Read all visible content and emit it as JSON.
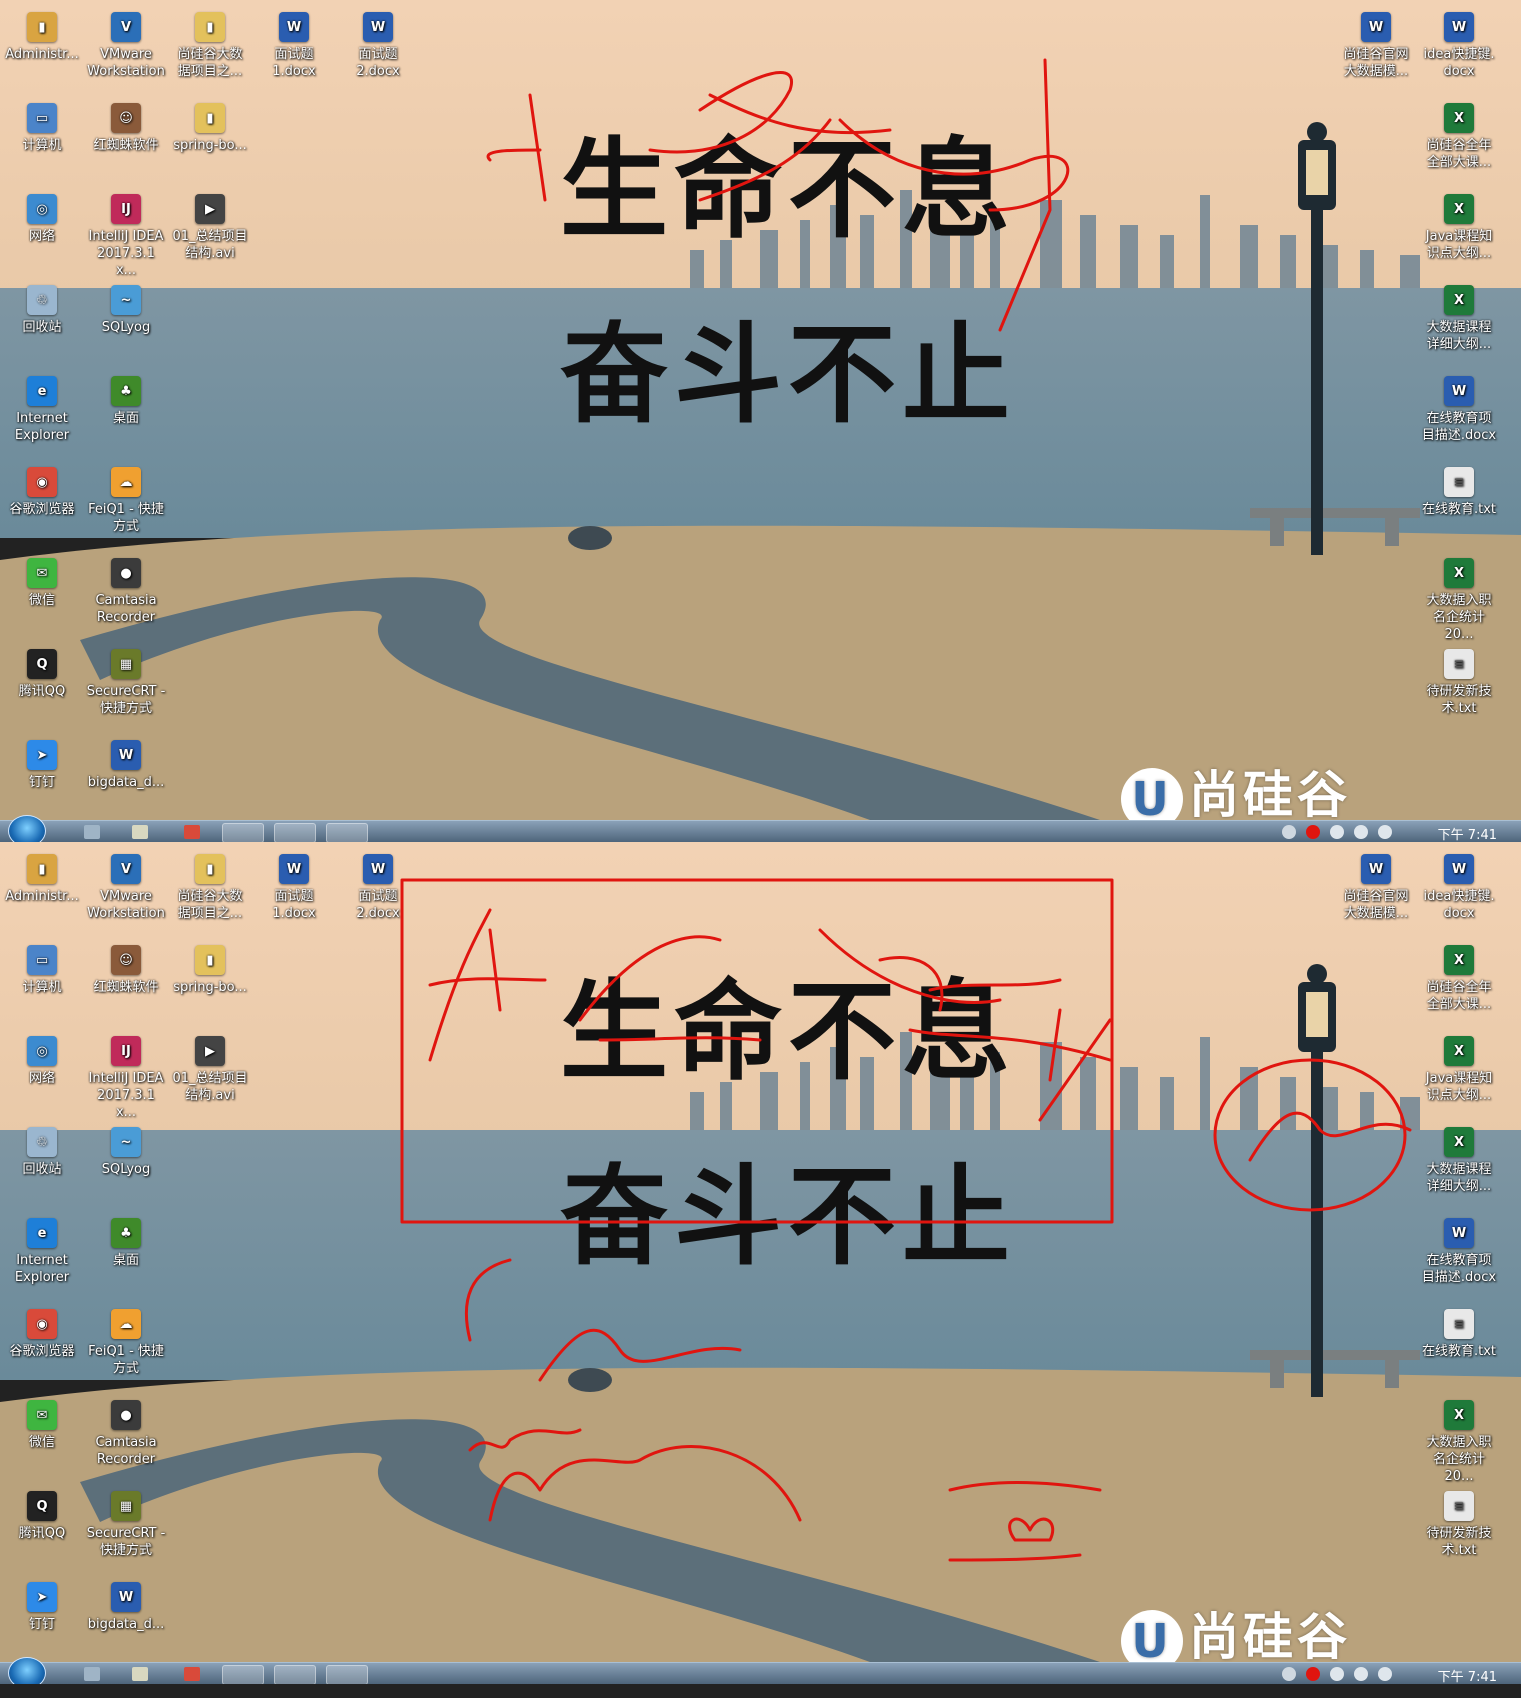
{
  "panels": [
    {
      "id": "top",
      "desktop_left": [
        {
          "name": "administrator-folder",
          "label": "Administr...",
          "color": "#d9a441",
          "glyph": "▮"
        },
        {
          "name": "vmware-workstation",
          "label": "VMware\nWorkstation",
          "color": "#2b6fb8",
          "glyph": "V"
        },
        {
          "name": "shangguigu-bigdata-folder",
          "label": "尚硅谷大数\n据项目之...",
          "color": "#e3c15c",
          "glyph": "▮"
        },
        {
          "name": "interview-1-docx",
          "label": "面试题\n1.docx",
          "color": "#2a5db0",
          "glyph": "W"
        },
        {
          "name": "interview-2-docx",
          "label": "面试题\n2.docx",
          "color": "#2a5db0",
          "glyph": "W"
        },
        {
          "name": "computer",
          "label": "计算机",
          "color": "#4b84c9",
          "glyph": "▭"
        },
        {
          "name": "hongzhizhu-software",
          "label": "红蜘蛛软件",
          "color": "#8a5a3a",
          "glyph": "☺"
        },
        {
          "name": "spring-boot-folder",
          "label": "spring-bo...",
          "color": "#e3c15c",
          "glyph": "▮"
        },
        {
          "name": "network",
          "label": "网络",
          "color": "#3c8bd0",
          "glyph": "◎"
        },
        {
          "name": "intellij-idea",
          "label": "IntelliJ IDEA\n2017.3.1 x...",
          "color": "#c02a5a",
          "glyph": "IJ"
        },
        {
          "name": "summary-video",
          "label": "01_总结项目\n结构.avi",
          "color": "#444",
          "glyph": "▶"
        },
        {
          "name": "recycle-bin",
          "label": "回收站",
          "color": "#9ab6cf",
          "glyph": "♲"
        },
        {
          "name": "sqlyog",
          "label": "SQLyog",
          "color": "#4a9cd6",
          "glyph": "~"
        },
        {
          "name": "internet-explorer",
          "label": "Internet\nExplorer",
          "color": "#1e7fd8",
          "glyph": "e"
        },
        {
          "name": "desktop-tree",
          "label": "桌面",
          "color": "#3f8a2a",
          "glyph": "♣"
        },
        {
          "name": "browser",
          "label": "谷歌浏览器",
          "color": "#d94a3a",
          "glyph": "◉"
        },
        {
          "name": "feiq",
          "label": "FeiQ1 - 快捷\n方式",
          "color": "#f0a030",
          "glyph": "☁"
        },
        {
          "name": "wechat",
          "label": "微信",
          "color": "#3fb540",
          "glyph": "✉"
        },
        {
          "name": "camtasia-recorder",
          "label": "Camtasia\nRecorder",
          "color": "#3b3b3b",
          "glyph": "●"
        },
        {
          "name": "tencent-qq",
          "label": "腾讯QQ",
          "color": "#222",
          "glyph": "Q"
        },
        {
          "name": "securecrt",
          "label": "SecureCRT -\n快捷方式",
          "color": "#6a7a2a",
          "glyph": "▦"
        },
        {
          "name": "dingtalk",
          "label": "钉钉",
          "color": "#2d8ae8",
          "glyph": "➤"
        },
        {
          "name": "bigdata-doc",
          "label": "bigdata_d...",
          "color": "#2a5db0",
          "glyph": "W"
        }
      ],
      "desktop_right": [
        {
          "name": "shangguigu-website-doc",
          "label": "尚硅谷官网\n大数据模...",
          "color": "#2a5db0",
          "glyph": "W"
        },
        {
          "name": "idea-shortcuts-doc",
          "label": "idea快捷键.\ndocx",
          "color": "#2a5db0",
          "glyph": "W"
        },
        {
          "name": "course-list-xls",
          "label": "尚硅谷全年\n全部大课...",
          "color": "#1f7a3a",
          "glyph": "X"
        },
        {
          "name": "java-course-xls",
          "label": "Java课程知\n识点大纲...",
          "color": "#1f7a3a",
          "glyph": "X"
        },
        {
          "name": "bigdata-course-xls",
          "label": "大数据课程\n详细大纲...",
          "color": "#1f7a3a",
          "glyph": "X"
        },
        {
          "name": "online-edu-doc",
          "label": "在线教育项\n目描述.docx",
          "color": "#2a5db0",
          "glyph": "W"
        },
        {
          "name": "online-edu-txt",
          "label": "在线教育.txt",
          "color": "#e8e8e8",
          "glyph": "≡"
        },
        {
          "name": "bigdata-jobs-xls",
          "label": "大数据入职\n名企统计20...",
          "color": "#1f7a3a",
          "glyph": "X"
        },
        {
          "name": "new-tech-txt",
          "label": "待研发新技\n术.txt",
          "color": "#e8e8e8",
          "glyph": "≡"
        }
      ],
      "callig_line1": "生命不息",
      "callig_line2": "奋斗不止",
      "logo_text": "尚硅谷",
      "logo_mark": "U",
      "clock": "下午 7:41"
    },
    {
      "id": "bottom",
      "desktop_left": [
        {
          "name": "administrator-folder",
          "label": "Administr...",
          "color": "#d9a441",
          "glyph": "▮"
        },
        {
          "name": "vmware-workstation",
          "label": "VMware\nWorkstation",
          "color": "#2b6fb8",
          "glyph": "V"
        },
        {
          "name": "shangguigu-bigdata-folder",
          "label": "尚硅谷大数\n据项目之...",
          "color": "#e3c15c",
          "glyph": "▮"
        },
        {
          "name": "interview-1-docx",
          "label": "面试题\n1.docx",
          "color": "#2a5db0",
          "glyph": "W"
        },
        {
          "name": "interview-2-docx",
          "label": "面试题\n2.docx",
          "color": "#2a5db0",
          "glyph": "W"
        },
        {
          "name": "computer",
          "label": "计算机",
          "color": "#4b84c9",
          "glyph": "▭"
        },
        {
          "name": "hongzhizhu-software",
          "label": "红蜘蛛软件",
          "color": "#8a5a3a",
          "glyph": "☺"
        },
        {
          "name": "spring-boot-folder",
          "label": "spring-bo...",
          "color": "#e3c15c",
          "glyph": "▮"
        },
        {
          "name": "network",
          "label": "网络",
          "color": "#3c8bd0",
          "glyph": "◎"
        },
        {
          "name": "intellij-idea",
          "label": "IntelliJ IDEA\n2017.3.1 x...",
          "color": "#c02a5a",
          "glyph": "IJ"
        },
        {
          "name": "summary-video",
          "label": "01_总结项目\n结构.avi",
          "color": "#444",
          "glyph": "▶"
        },
        {
          "name": "recycle-bin",
          "label": "回收站",
          "color": "#9ab6cf",
          "glyph": "♲"
        },
        {
          "name": "sqlyog",
          "label": "SQLyog",
          "color": "#4a9cd6",
          "glyph": "~"
        },
        {
          "name": "internet-explorer",
          "label": "Internet\nExplorer",
          "color": "#1e7fd8",
          "glyph": "e"
        },
        {
          "name": "desktop-tree",
          "label": "桌面",
          "color": "#3f8a2a",
          "glyph": "♣"
        },
        {
          "name": "browser",
          "label": "谷歌浏览器",
          "color": "#d94a3a",
          "glyph": "◉"
        },
        {
          "name": "feiq",
          "label": "FeiQ1 - 快捷\n方式",
          "color": "#f0a030",
          "glyph": "☁"
        },
        {
          "name": "wechat",
          "label": "微信",
          "color": "#3fb540",
          "glyph": "✉"
        },
        {
          "name": "camtasia-recorder",
          "label": "Camtasia\nRecorder",
          "color": "#3b3b3b",
          "glyph": "●"
        },
        {
          "name": "tencent-qq",
          "label": "腾讯QQ",
          "color": "#222",
          "glyph": "Q"
        },
        {
          "name": "securecrt",
          "label": "SecureCRT -\n快捷方式",
          "color": "#6a7a2a",
          "glyph": "▦"
        },
        {
          "name": "dingtalk",
          "label": "钉钉",
          "color": "#2d8ae8",
          "glyph": "➤"
        },
        {
          "name": "bigdata-doc",
          "label": "bigdata_d...",
          "color": "#2a5db0",
          "glyph": "W"
        }
      ],
      "desktop_right": [
        {
          "name": "shangguigu-website-doc",
          "label": "尚硅谷官网\n大数据模...",
          "color": "#2a5db0",
          "glyph": "W"
        },
        {
          "name": "idea-shortcuts-doc",
          "label": "idea快捷键.\ndocx",
          "color": "#2a5db0",
          "glyph": "W"
        },
        {
          "name": "course-list-xls",
          "label": "尚硅谷全年\n全部大课...",
          "color": "#1f7a3a",
          "glyph": "X"
        },
        {
          "name": "java-course-xls",
          "label": "Java课程知\n识点大纲...",
          "color": "#1f7a3a",
          "glyph": "X"
        },
        {
          "name": "bigdata-course-xls",
          "label": "大数据课程\n详细大纲...",
          "color": "#1f7a3a",
          "glyph": "X"
        },
        {
          "name": "online-edu-doc",
          "label": "在线教育项\n目描述.docx",
          "color": "#2a5db0",
          "glyph": "W"
        },
        {
          "name": "online-edu-txt",
          "label": "在线教育.txt",
          "color": "#e8e8e8",
          "glyph": "≡"
        },
        {
          "name": "bigdata-jobs-xls",
          "label": "大数据入职\n名企统计20...",
          "color": "#1f7a3a",
          "glyph": "X"
        },
        {
          "name": "new-tech-txt",
          "label": "待研发新技\n术.txt",
          "color": "#e8e8e8",
          "glyph": "≡"
        }
      ],
      "callig_line1": "生命不息",
      "callig_line2": "奋斗不止",
      "logo_text": "尚硅谷",
      "logo_mark": "U",
      "clock": "下午 7:41"
    }
  ],
  "colors": {
    "ink_red": "#e0150f",
    "sky_top": "#f2d2b4",
    "sky_horizon": "#e9c9a8",
    "water": "#6a8a9a",
    "grass": "#b9a27c",
    "path": "#5c6f7a"
  }
}
